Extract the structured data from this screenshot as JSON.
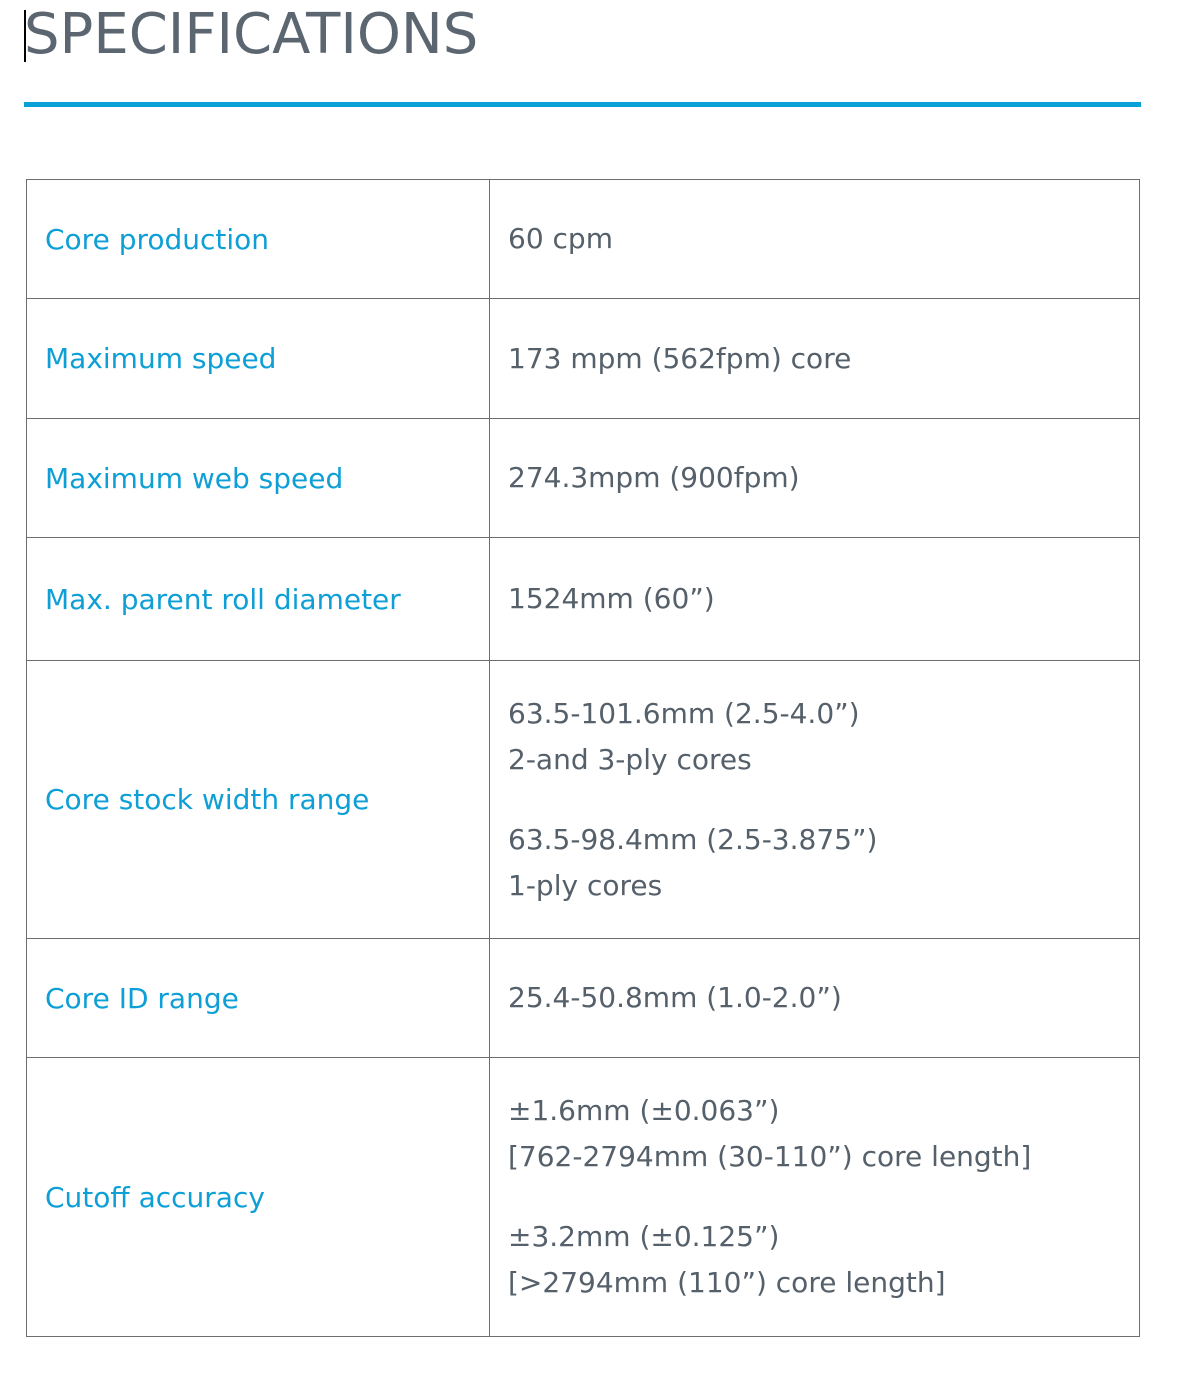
{
  "page": {
    "title": "SPECIFICATIONS",
    "accent_color": "#0aa0d8",
    "label_color": "#0e9fd6",
    "value_color": "#55606a"
  },
  "specs": [
    {
      "label": "Core production",
      "value_blocks": [
        [
          "60 cpm"
        ]
      ]
    },
    {
      "label": "Maximum speed",
      "value_blocks": [
        [
          "173 mpm (562fpm) core"
        ]
      ]
    },
    {
      "label": "Maximum web speed",
      "value_blocks": [
        [
          "274.3mpm (900fpm)"
        ]
      ]
    },
    {
      "label": "Max. parent roll diameter",
      "value_blocks": [
        [
          "1524mm (60”)"
        ]
      ]
    },
    {
      "label": "Core stock width range",
      "value_blocks": [
        [
          "63.5-101.6mm (2.5-4.0”)",
          "2-and 3-ply cores"
        ],
        [
          "63.5-98.4mm (2.5-3.875”)",
          "1-ply cores"
        ]
      ]
    },
    {
      "label": "Core ID range",
      "value_blocks": [
        [
          "25.4-50.8mm (1.0-2.0”)"
        ]
      ]
    },
    {
      "label": "Cutoff accuracy",
      "value_blocks": [
        [
          "±1.6mm (±0.063”)",
          "[762-2794mm (30-110”) core length]"
        ],
        [
          "±3.2mm (±0.125”)",
          "[>2794mm (110”) core length]"
        ]
      ]
    }
  ]
}
